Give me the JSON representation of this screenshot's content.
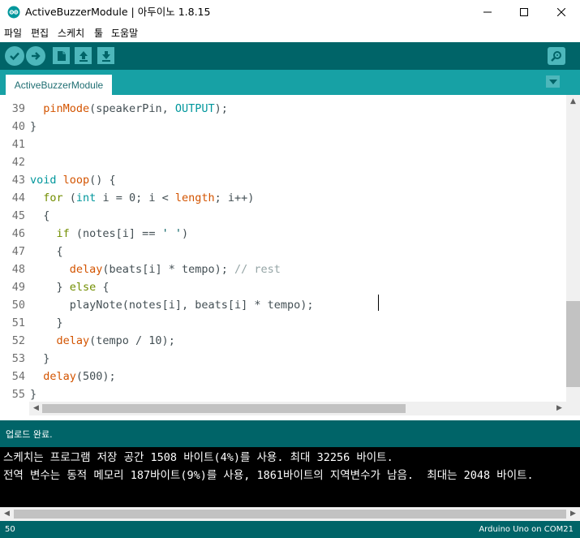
{
  "window": {
    "title": "ActiveBuzzerModule | 아두이노 1.8.15",
    "minimize_glyph": "─",
    "maximize_glyph": "☐",
    "close_glyph": "✕"
  },
  "menu": {
    "items": [
      "파일",
      "편집",
      "스케치",
      "툴",
      "도움말"
    ]
  },
  "toolbar": {
    "buttons": [
      "verify-icon",
      "upload-icon",
      "new-icon",
      "open-icon",
      "save-icon"
    ],
    "serial_monitor": "serial-monitor-icon"
  },
  "tabs": {
    "active": "ActiveBuzzerModule"
  },
  "editor": {
    "line_numbers": [
      "39",
      "40",
      "41",
      "42",
      "43",
      "44",
      "45",
      "46",
      "47",
      "48",
      "49",
      "50",
      "51",
      "52",
      "53",
      "54",
      "55"
    ],
    "lines": [
      {
        "indent": "  ",
        "tokens": [
          {
            "t": "pinMode",
            "c": "kw-func"
          },
          {
            "t": "(speakerPin, ",
            "c": ""
          },
          {
            "t": "OUTPUT",
            "c": "kw-type"
          },
          {
            "t": ");",
            "c": ""
          }
        ]
      },
      {
        "indent": "",
        "tokens": [
          {
            "t": "}",
            "c": ""
          }
        ]
      },
      {
        "indent": "",
        "tokens": []
      },
      {
        "indent": "",
        "tokens": []
      },
      {
        "indent": "",
        "tokens": [
          {
            "t": "void",
            "c": "kw-type"
          },
          {
            "t": " ",
            "c": ""
          },
          {
            "t": "loop",
            "c": "kw-func"
          },
          {
            "t": "() {",
            "c": ""
          }
        ]
      },
      {
        "indent": "  ",
        "tokens": [
          {
            "t": "for",
            "c": "kw-ctrl"
          },
          {
            "t": " (",
            "c": ""
          },
          {
            "t": "int",
            "c": "kw-type"
          },
          {
            "t": " i = 0; i < ",
            "c": ""
          },
          {
            "t": "length",
            "c": "kw-func"
          },
          {
            "t": "; i++)",
            "c": ""
          }
        ]
      },
      {
        "indent": "  ",
        "tokens": [
          {
            "t": "{",
            "c": ""
          }
        ]
      },
      {
        "indent": "    ",
        "tokens": [
          {
            "t": "if",
            "c": "kw-ctrl"
          },
          {
            "t": " (notes[i] == ",
            "c": ""
          },
          {
            "t": "' '",
            "c": "str"
          },
          {
            "t": ")",
            "c": ""
          }
        ]
      },
      {
        "indent": "    ",
        "tokens": [
          {
            "t": "{",
            "c": ""
          }
        ]
      },
      {
        "indent": "      ",
        "tokens": [
          {
            "t": "delay",
            "c": "kw-func"
          },
          {
            "t": "(beats[i] * tempo); ",
            "c": ""
          },
          {
            "t": "// rest",
            "c": "cmt"
          }
        ]
      },
      {
        "indent": "    ",
        "tokens": [
          {
            "t": "} ",
            "c": ""
          },
          {
            "t": "else",
            "c": "kw-ctrl"
          },
          {
            "t": " {",
            "c": ""
          }
        ]
      },
      {
        "indent": "      ",
        "tokens": [
          {
            "t": "playNote(notes[i], beats[i] * tempo);",
            "c": ""
          }
        ]
      },
      {
        "indent": "    ",
        "tokens": [
          {
            "t": "}",
            "c": ""
          }
        ]
      },
      {
        "indent": "    ",
        "tokens": [
          {
            "t": "delay",
            "c": "kw-func"
          },
          {
            "t": "(tempo / 10);",
            "c": ""
          }
        ]
      },
      {
        "indent": "  ",
        "tokens": [
          {
            "t": "}",
            "c": ""
          }
        ]
      },
      {
        "indent": "  ",
        "tokens": [
          {
            "t": "delay",
            "c": "kw-func"
          },
          {
            "t": "(500);",
            "c": ""
          }
        ]
      },
      {
        "indent": "",
        "tokens": [
          {
            "t": "}",
            "c": ""
          }
        ]
      }
    ]
  },
  "status": {
    "message": "업로드 완료."
  },
  "console": {
    "lines": [
      "스케치는 프로그램 저장 공간 1508 바이트(4%)를 사용. 최대 32256 바이트.",
      "전역 변수는 동적 메모리 187바이트(9%)를 사용, 1861바이트의 지역변수가 남음.  최대는 2048 바이트."
    ]
  },
  "footer": {
    "line_number": "50",
    "board": "Arduino Uno on COM21"
  },
  "colors": {
    "toolbar": "#006468",
    "tabbar": "#17a1a5",
    "button": "#4db7bb"
  }
}
